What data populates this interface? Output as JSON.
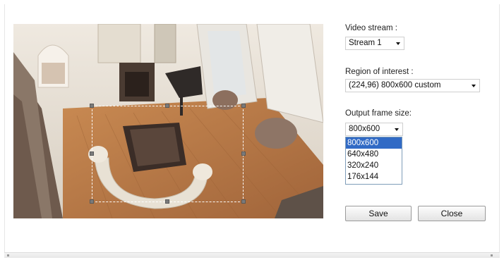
{
  "video_stream": {
    "label": "Video stream :",
    "selected": "Stream 1"
  },
  "region_of_interest": {
    "label": "Region of interest :",
    "selected": "(224,96) 800x600 custom"
  },
  "output_frame_size": {
    "label": "Output frame size:",
    "selected": "800x600",
    "options": [
      "800x600",
      "640x480",
      "320x240",
      "176x144"
    ],
    "highlighted_index": 0
  },
  "buttons": {
    "save": "Save",
    "close": "Close"
  },
  "colors": {
    "option_highlight": "#316ac5",
    "roi_handle": "#7b7b7b"
  }
}
